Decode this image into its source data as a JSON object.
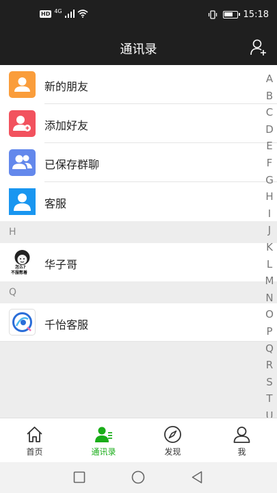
{
  "status": {
    "hd_badge": "HD",
    "net_type": "4G",
    "time": "15:18",
    "battery_level": 0.7
  },
  "header": {
    "title": "通讯录"
  },
  "top_items": [
    {
      "label": "新的朋友",
      "color": "#fa9d3b",
      "icon": "new-friends-icon"
    },
    {
      "label": "添加好友",
      "color": "#f2525e",
      "icon": "add-friend-icon"
    },
    {
      "label": "已保存群聊",
      "color": "#6388ec",
      "icon": "group-chat-icon"
    },
    {
      "label": "客服",
      "color": "#1996f0",
      "icon": "customer-service-icon"
    }
  ],
  "sections": [
    {
      "letter": "H",
      "contacts": [
        {
          "name": "华子哥",
          "avatar_caption_1": "怎么?",
          "avatar_caption_2": "不服憋着"
        }
      ]
    },
    {
      "letter": "Q",
      "contacts": [
        {
          "name": "千怡客服",
          "avatar_caption_1": "",
          "avatar_caption_2": ""
        }
      ]
    }
  ],
  "index_letters": [
    "A",
    "B",
    "C",
    "D",
    "E",
    "F",
    "G",
    "H",
    "I",
    "J",
    "K",
    "L",
    "M",
    "N",
    "O",
    "P",
    "Q",
    "R",
    "S",
    "T",
    "U"
  ],
  "tabs": [
    {
      "label": "首页",
      "icon": "home-icon"
    },
    {
      "label": "通讯录",
      "icon": "contacts-icon"
    },
    {
      "label": "发现",
      "icon": "compass-icon"
    },
    {
      "label": "我",
      "icon": "profile-icon"
    }
  ],
  "colors": {
    "active_tab": "#1aad19",
    "header_bg": "#1f1f1f"
  }
}
